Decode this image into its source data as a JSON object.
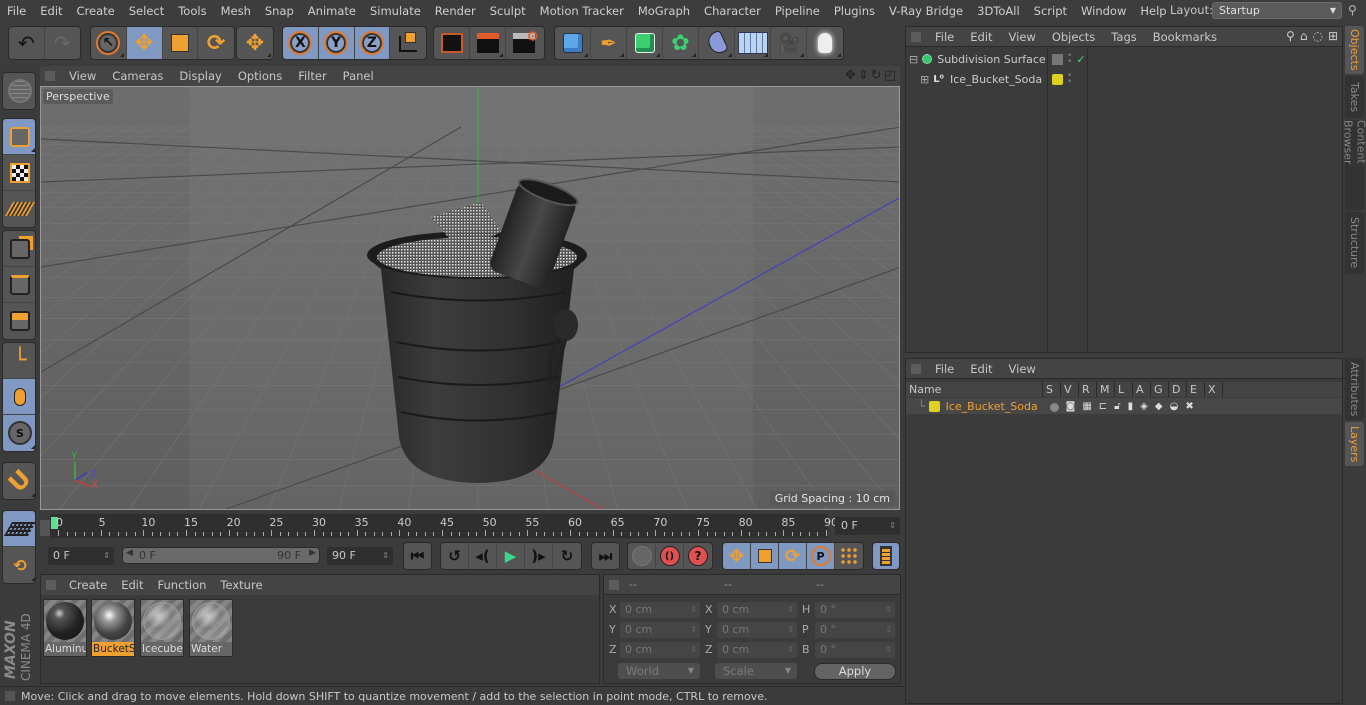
{
  "menubar": {
    "items": [
      "File",
      "Edit",
      "Create",
      "Select",
      "Tools",
      "Mesh",
      "Snap",
      "Animate",
      "Simulate",
      "Render",
      "Sculpt",
      "Motion Tracker",
      "MoGraph",
      "Character",
      "Pipeline",
      "Plugins",
      "V-Ray Bridge",
      "3DToAll",
      "Script",
      "Window",
      "Help"
    ],
    "layout_label": "Layout:",
    "layout_value": "Startup"
  },
  "toolbar": {
    "groups": [
      {
        "name": "history",
        "buttons": [
          {
            "icon": "undo-icon"
          },
          {
            "icon": "redo-icon"
          }
        ]
      },
      {
        "name": "tools",
        "buttons": [
          {
            "icon": "live-selection-icon"
          },
          {
            "icon": "move-icon",
            "active": true
          },
          {
            "icon": "scale-icon"
          },
          {
            "icon": "rotate-icon"
          }
        ]
      },
      {
        "name": "recent",
        "buttons": [
          {
            "icon": "move-recent-icon"
          }
        ]
      },
      {
        "name": "axis",
        "buttons": [
          {
            "icon": "x-axis-icon",
            "label": "X",
            "active": true
          },
          {
            "icon": "y-axis-icon",
            "label": "Y",
            "active": true
          },
          {
            "icon": "z-axis-icon",
            "label": "Z",
            "active": true
          },
          {
            "icon": "coordinate-system-icon"
          }
        ]
      },
      {
        "name": "render",
        "buttons": [
          {
            "icon": "render-view-icon"
          },
          {
            "icon": "render-picture-viewer-icon"
          },
          {
            "icon": "render-settings-icon"
          }
        ]
      },
      {
        "name": "objects",
        "buttons": [
          {
            "icon": "cube-icon"
          },
          {
            "icon": "pen-spline-icon"
          },
          {
            "icon": "subdivision-surface-icon"
          },
          {
            "icon": "cloner-icon"
          },
          {
            "icon": "deformer-icon"
          },
          {
            "icon": "floor-icon"
          },
          {
            "icon": "camera-icon"
          },
          {
            "icon": "light-icon"
          }
        ]
      }
    ]
  },
  "left_tools": [
    {
      "icon": "make-editable-icon"
    },
    {
      "icon": "model-mode-icon",
      "active": true
    },
    {
      "icon": "texture-mode-icon"
    },
    {
      "icon": "workplane-mode-icon"
    },
    {
      "icon": "points-mode-icon"
    },
    {
      "icon": "edges-mode-icon"
    },
    {
      "icon": "polygons-mode-icon"
    },
    {
      "icon": "axis-mode-icon"
    },
    {
      "icon": "tweak-mode-icon",
      "active": true
    },
    {
      "icon": "solo-mode-icon",
      "active": true
    },
    {
      "icon": "snap-magnet-icon"
    },
    {
      "icon": "workplane-lock-icon",
      "active": true
    },
    {
      "icon": "workplane-align-icon"
    }
  ],
  "branding": {
    "line1": "MAXON",
    "line2": "CINEMA 4D"
  },
  "viewport": {
    "menu": [
      "View",
      "Cameras",
      "Display",
      "Options",
      "Filter",
      "Panel"
    ],
    "label": "Perspective",
    "grid_spacing": "Grid Spacing : 10 cm",
    "axis_labels": {
      "x": "X",
      "y": "Y",
      "z": "Z"
    }
  },
  "timeline": {
    "ticks": [
      0,
      5,
      10,
      15,
      20,
      25,
      30,
      35,
      40,
      45,
      50,
      55,
      60,
      65,
      70,
      75,
      80,
      85,
      90
    ],
    "current_frame": "0 F",
    "start_field": "0 F",
    "range_start": "0 F",
    "range_end": "90 F",
    "end_field": "90 F"
  },
  "transport": {
    "buttons": [
      "go-to-start-icon",
      "previous-key-icon",
      "previous-frame-icon",
      "play-icon",
      "next-frame-icon",
      "next-key-icon",
      "go-to-end-icon"
    ],
    "record_buttons": [
      "keyframe-selection-icon",
      "record-active-icon",
      "autokey-icon"
    ],
    "key_buttons": [
      "key-position-icon",
      "key-scale-icon",
      "key-rotation-icon",
      "key-parameter-icon",
      "key-pla-icon"
    ],
    "timeline_button": "timeline-icon"
  },
  "material_manager": {
    "menu": [
      "Create",
      "Edit",
      "Function",
      "Texture"
    ],
    "materials": [
      {
        "name": "Aluminu",
        "selected": false
      },
      {
        "name": "BucketS",
        "selected": true
      },
      {
        "name": "Icecube:",
        "selected": false
      },
      {
        "name": "Water",
        "selected": false
      }
    ]
  },
  "coordinates": {
    "headers": [
      "--",
      "--",
      "--"
    ],
    "rows": [
      {
        "a": "X",
        "av": "0 cm",
        "b": "X",
        "bv": "0 cm",
        "c": "H",
        "cv": "0 °"
      },
      {
        "a": "Y",
        "av": "0 cm",
        "b": "Y",
        "bv": "0 cm",
        "c": "P",
        "cv": "0 °"
      },
      {
        "a": "Z",
        "av": "0 cm",
        "b": "Z",
        "bv": "0 cm",
        "c": "B",
        "cv": "0 °"
      }
    ],
    "mode": "World",
    "transform": "Scale",
    "apply": "Apply"
  },
  "status": "Move: Click and drag to move elements. Hold down SHIFT to quantize movement / add to the selection in point mode, CTRL to remove.",
  "object_manager": {
    "menu": [
      "File",
      "Edit",
      "View",
      "Objects",
      "Tags",
      "Bookmarks"
    ],
    "objects": [
      {
        "name": "Subdivision Surface",
        "expander": "⊟",
        "color": "#33c86a"
      },
      {
        "name": "Ice_Bucket_Soda",
        "expander": "⊞",
        "color": "#dcd020"
      }
    ]
  },
  "layer_manager": {
    "menu": [
      "File",
      "Edit",
      "View"
    ],
    "columns": [
      "Name",
      "S",
      "V",
      "R",
      "M",
      "L",
      "A",
      "G",
      "D",
      "E",
      "X"
    ],
    "layers": [
      {
        "name": "Ice_Bucket_Soda",
        "color": "#e0d020"
      }
    ]
  },
  "side_tabs": {
    "top": [
      {
        "label": "Objects",
        "active": true
      },
      {
        "label": "Takes"
      },
      {
        "label": "Content Browser"
      },
      {
        "label": "Structure"
      }
    ],
    "bottom": [
      {
        "label": "Attributes"
      },
      {
        "label": "Layers",
        "active": true
      }
    ]
  },
  "colors": {
    "accent": "#f0a030",
    "active_button": "#7f99c3",
    "playhead": "#5fe08f"
  }
}
